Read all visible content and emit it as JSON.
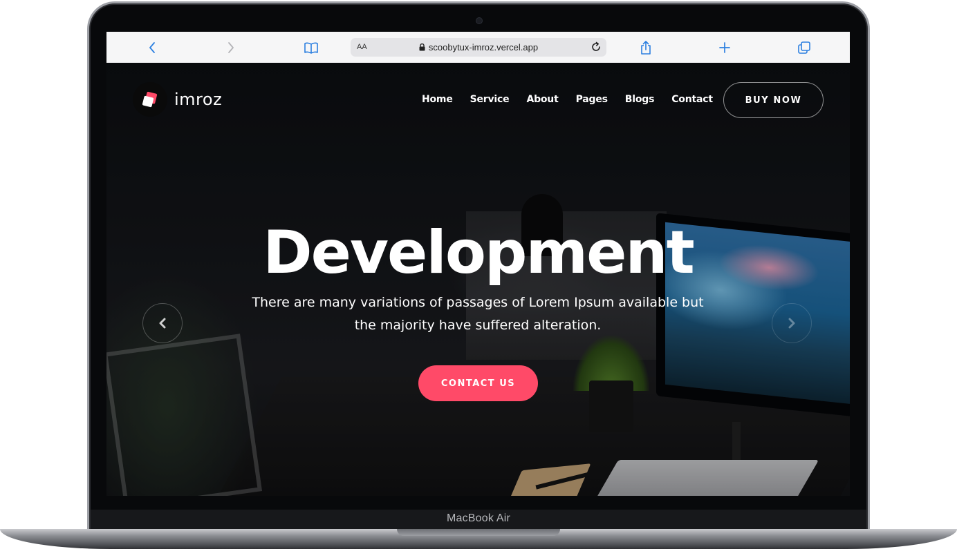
{
  "device": {
    "label": "MacBook Air"
  },
  "browser": {
    "text_size_label": "AA",
    "url": "scoobytux-imroz.vercel.app",
    "icons": [
      "back-icon",
      "forward-icon",
      "bookmarks-icon",
      "lock-icon",
      "reload-icon",
      "share-icon",
      "new-tab-icon",
      "tabs-icon"
    ]
  },
  "site": {
    "brand": "imroz",
    "accent_color": "#ff4a68",
    "nav": {
      "items": [
        "Home",
        "Service",
        "About",
        "Pages",
        "Blogs",
        "Contact"
      ],
      "cta": "BUY NOW"
    },
    "hero": {
      "title": "Development",
      "subtitle_line1": "There are many variations of passages of Lorem Ipsum available but",
      "subtitle_line2": "the majority have suffered alteration.",
      "button": "CONTACT US"
    }
  }
}
